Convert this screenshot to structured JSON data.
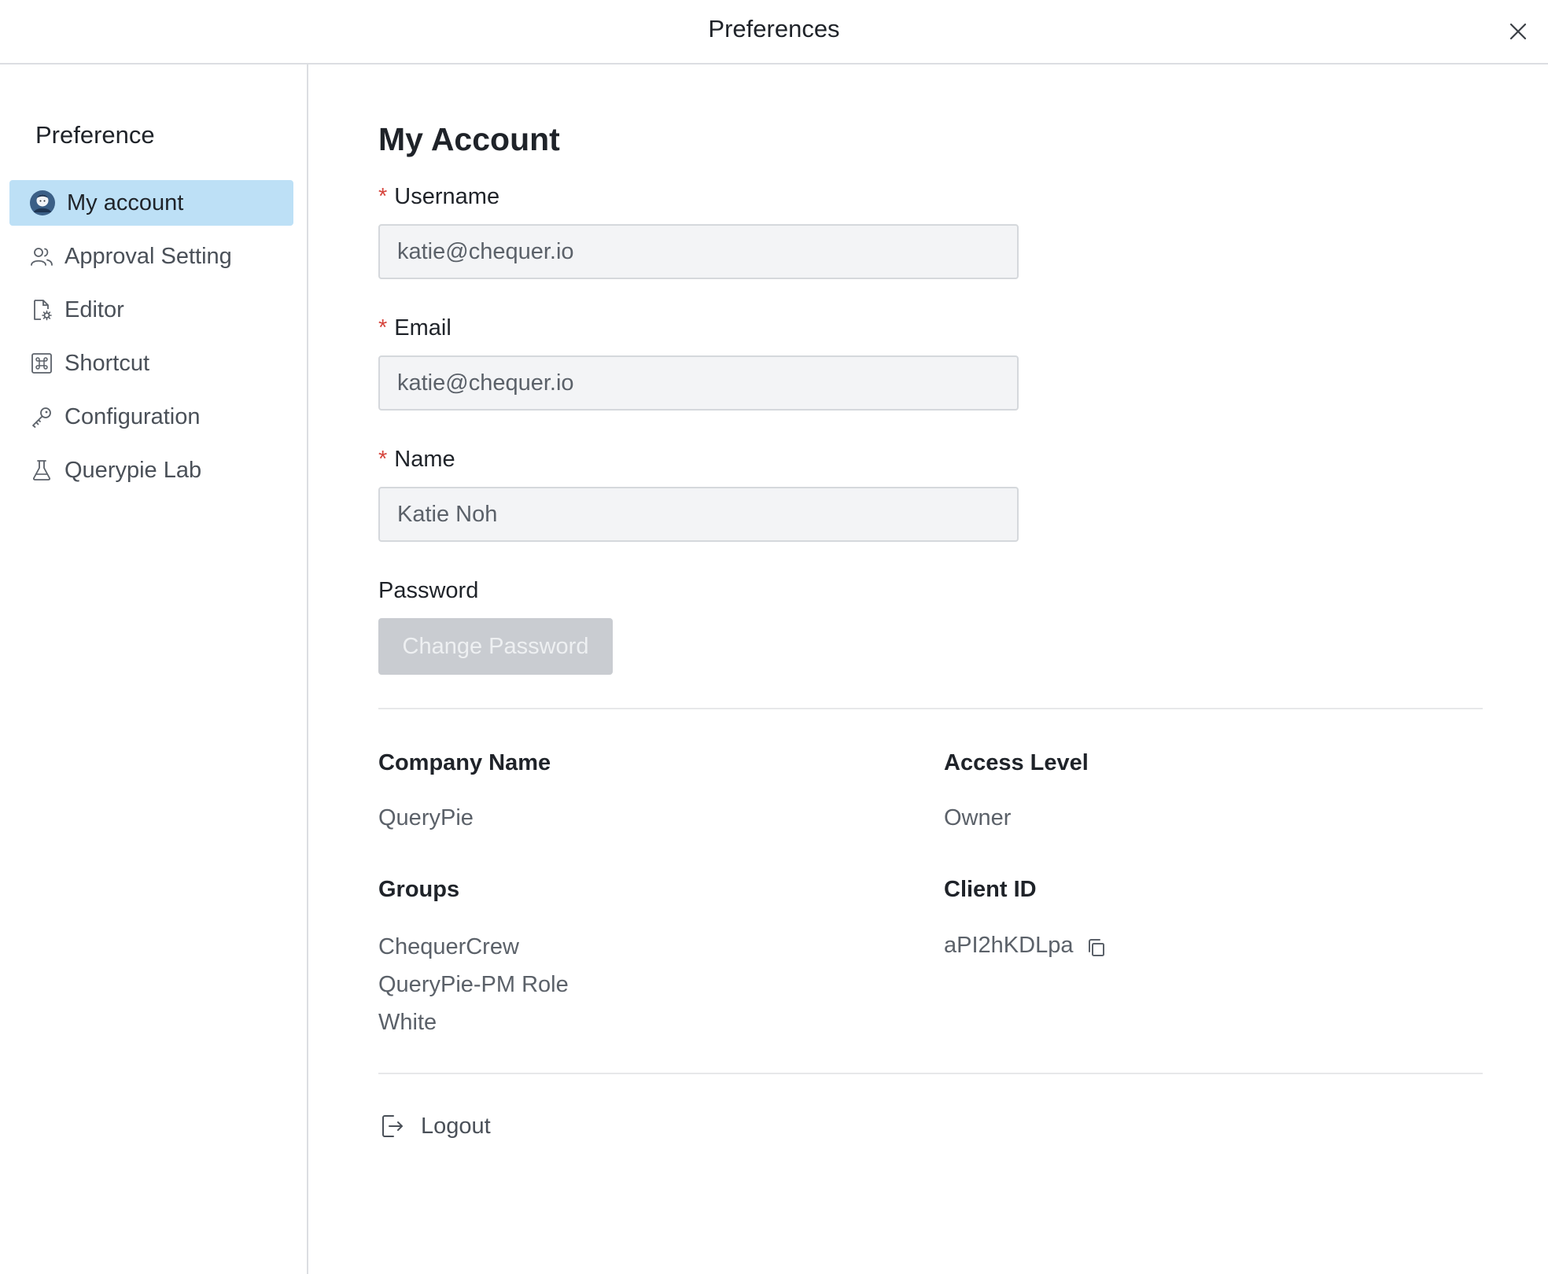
{
  "window": {
    "title": "Preferences",
    "close_icon": "close-icon"
  },
  "sidebar": {
    "title": "Preference",
    "items": [
      {
        "label": "My account",
        "icon": "avatar-icon",
        "active": true
      },
      {
        "label": "Approval Setting",
        "icon": "users-icon",
        "active": false
      },
      {
        "label": "Editor",
        "icon": "file-settings-icon",
        "active": false
      },
      {
        "label": "Shortcut",
        "icon": "command-key-icon",
        "active": false
      },
      {
        "label": "Configuration",
        "icon": "key-icon",
        "active": false
      },
      {
        "label": "Querypie Lab",
        "icon": "flask-icon",
        "active": false
      }
    ]
  },
  "main": {
    "title": "My Account",
    "required_marker": "*",
    "username": {
      "label": "Username",
      "value": "katie@chequer.io"
    },
    "email": {
      "label": "Email",
      "value": "katie@chequer.io"
    },
    "name": {
      "label": "Name",
      "value": "Katie Noh"
    },
    "password": {
      "label": "Password",
      "button_label": "Change Password"
    },
    "company": {
      "label": "Company Name",
      "value": "QueryPie"
    },
    "access_level": {
      "label": "Access Level",
      "value": "Owner"
    },
    "groups": {
      "label": "Groups",
      "values": [
        "ChequerCrew",
        "QueryPie-PM Role",
        "White"
      ]
    },
    "client_id": {
      "label": "Client ID",
      "value": "aPI2hKDLpa",
      "copy_icon": "copy-icon"
    },
    "logout": {
      "label": "Logout",
      "icon": "logout-icon"
    }
  },
  "colors": {
    "active_nav_bg": "#bde0f6",
    "required": "#d6453d",
    "input_bg": "#f3f4f6",
    "disabled_button_bg": "#c9ccd1"
  }
}
